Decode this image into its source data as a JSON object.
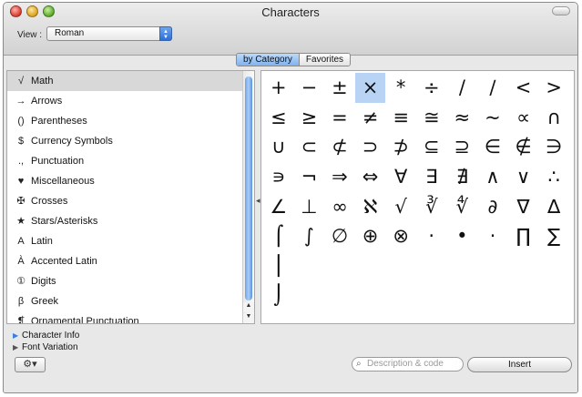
{
  "window": {
    "title": "Characters"
  },
  "view": {
    "label": "View :",
    "selected": "Roman"
  },
  "tabs": [
    {
      "label": "by Category",
      "active": true
    },
    {
      "label": "Favorites",
      "active": false
    }
  ],
  "categories": [
    {
      "icon": "√",
      "label": "Math",
      "selected": true
    },
    {
      "icon": "→",
      "label": "Arrows"
    },
    {
      "icon": "()",
      "label": "Parentheses"
    },
    {
      "icon": "$",
      "label": "Currency Symbols"
    },
    {
      "icon": ".,",
      "label": "Punctuation"
    },
    {
      "icon": "♥",
      "label": "Miscellaneous"
    },
    {
      "icon": "✠",
      "label": "Crosses"
    },
    {
      "icon": "★",
      "label": "Stars/Asterisks"
    },
    {
      "icon": "A",
      "label": "Latin"
    },
    {
      "icon": "À",
      "label": "Accented Latin"
    },
    {
      "icon": "①",
      "label": "Digits"
    },
    {
      "icon": "β",
      "label": "Greek"
    },
    {
      "icon": "❡",
      "label": "Ornamental Punctuation"
    }
  ],
  "characters": [
    "+",
    "−",
    "±",
    "×",
    "*",
    "÷",
    "/",
    "∕",
    "<",
    ">",
    "≤",
    "≥",
    "=",
    "≠",
    "≡",
    "≅",
    "≈",
    "~",
    "∝",
    "∩",
    "∪",
    "⊂",
    "⊄",
    "⊃",
    "⊅",
    "⊆",
    "⊇",
    "∈",
    "∉",
    "∋",
    "∍",
    "¬",
    "⇒",
    "⇔",
    "∀",
    "∃",
    "∄",
    "∧",
    "∨",
    "∴",
    "∠",
    "⊥",
    "∞",
    "ℵ",
    "√",
    "∛",
    "∜",
    "∂",
    "∇",
    "∆",
    "⌠",
    "∫",
    "∅",
    "⊕",
    "⊗",
    "·",
    "•",
    "⋅",
    "∏",
    "∑",
    "⎮",
    "",
    "",
    "",
    "",
    "",
    "",
    "",
    "",
    "",
    "⌡"
  ],
  "selected_character_index": 3,
  "info": {
    "character_info": "Character Info",
    "font_variation": "Font Variation"
  },
  "gear": {
    "icon": "gear-icon",
    "symbol": "⚙▾"
  },
  "search": {
    "placeholder": "Description & code"
  },
  "insert": {
    "label": "Insert"
  },
  "colors": {
    "selection_blue": "#b9d3f4",
    "active_tab": "#7fb3ee",
    "scroll_thumb": "#6da3ea"
  }
}
